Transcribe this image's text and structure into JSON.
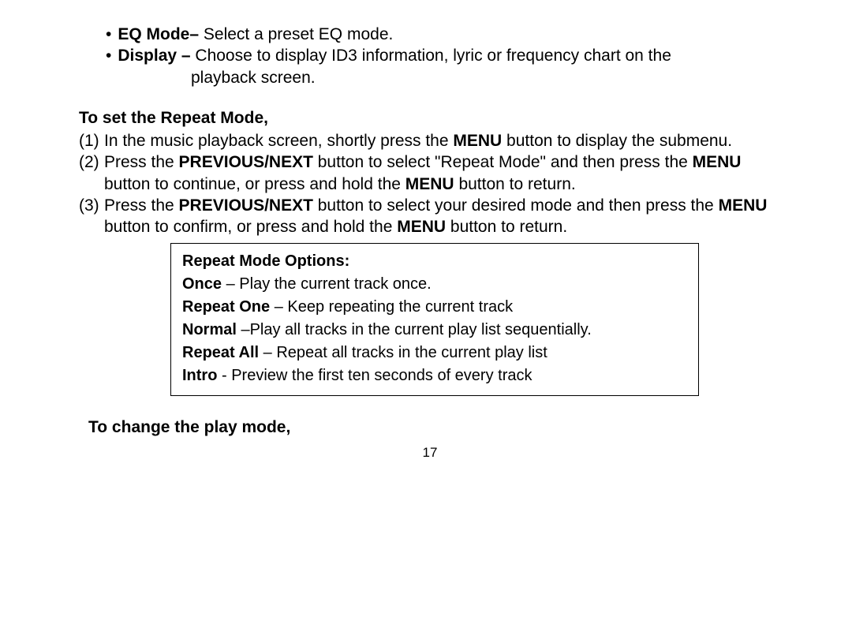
{
  "bullets": [
    {
      "term": "EQ Mode–",
      "desc": " Select a preset EQ mode."
    },
    {
      "term": "Display –",
      "desc": " Choose to display ID3 information, lyric or frequency chart on the",
      "cont": "playback screen."
    }
  ],
  "heading1": "To set the Repeat Mode,",
  "steps": [
    {
      "num": "(1)",
      "parts": [
        {
          "t": "In the music playback screen, shortly press the "
        },
        {
          "t": "MENU",
          "b": true
        },
        {
          "t": " button to display the submenu."
        }
      ]
    },
    {
      "num": "(2)",
      "parts": [
        {
          "t": "Press the "
        },
        {
          "t": "PREVIOUS/NEXT",
          "b": true
        },
        {
          "t": " button to select \"Repeat Mode\" and then press the "
        },
        {
          "t": "MENU",
          "b": true
        },
        {
          "t": " button to continue, or press and hold the "
        },
        {
          "t": "MENU",
          "b": true
        },
        {
          "t": " button to return."
        }
      ]
    },
    {
      "num": "(3)",
      "parts": [
        {
          "t": "Press the "
        },
        {
          "t": "PREVIOUS/NEXT",
          "b": true
        },
        {
          "t": " button to select your desired mode and then press the "
        },
        {
          "t": "MENU",
          "b": true
        },
        {
          "t": " button to confirm, or press and hold the "
        },
        {
          "t": "MENU",
          "b": true
        },
        {
          "t": " button to return."
        }
      ]
    }
  ],
  "optbox": {
    "title": "Repeat Mode Options:",
    "items": [
      {
        "term": "Once",
        "sep": " – ",
        "desc": "Play the current track once."
      },
      {
        "term": "Repeat One",
        "sep": " – ",
        "desc": "Keep repeating the current track"
      },
      {
        "term": "Normal",
        "sep": " –",
        "desc": "Play all tracks in the current play list sequentially."
      },
      {
        "term": "Repeat All",
        "sep": " – ",
        "desc": "Repeat all tracks in the current play list"
      },
      {
        "term": "Intro",
        "sep": " - ",
        "desc": "Preview the first ten seconds of every track"
      }
    ]
  },
  "heading2": "To change the play mode,",
  "pagenum": "17"
}
